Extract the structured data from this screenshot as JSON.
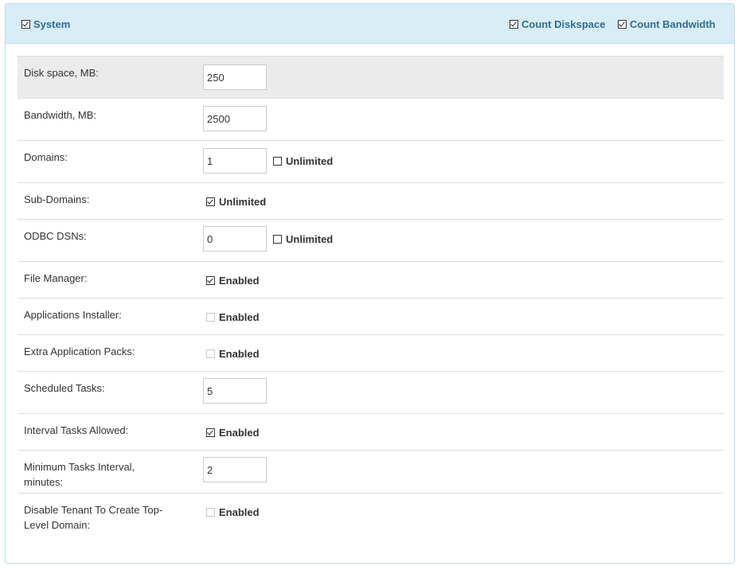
{
  "header": {
    "system_label": "System",
    "system_checked": true,
    "count_diskspace_label": "Count Diskspace",
    "count_diskspace_checked": true,
    "count_bandwidth_label": "Count Bandwidth",
    "count_bandwidth_checked": true
  },
  "rows": [
    {
      "label": "Disk space, MB:",
      "value": "250"
    },
    {
      "label": "Bandwidth, MB:",
      "value": "2500"
    },
    {
      "label": "Domains:",
      "value": "1",
      "checkbox_label": "Unlimited",
      "checked": false
    },
    {
      "label": "Sub-Domains:",
      "checkbox_label": "Unlimited",
      "checked": true
    },
    {
      "label": "ODBC DSNs:",
      "value": "0",
      "checkbox_label": "Unlimited",
      "checked": false
    },
    {
      "label": "File Manager:",
      "checkbox_label": "Enabled",
      "checked": true
    },
    {
      "label": "Applications Installer:",
      "checkbox_label": "Enabled",
      "checked": false
    },
    {
      "label": "Extra Application Packs:",
      "checkbox_label": "Enabled",
      "checked": false
    },
    {
      "label": "Scheduled Tasks:",
      "value": "5"
    },
    {
      "label": "Interval Tasks Allowed:",
      "checkbox_label": "Enabled",
      "checked": true
    },
    {
      "label": "Minimum Tasks Interval, minutes:",
      "value": "2"
    },
    {
      "label": "Disable Tenant To Create Top-Level Domain:",
      "checkbox_label": "Enabled",
      "checked": false
    }
  ]
}
